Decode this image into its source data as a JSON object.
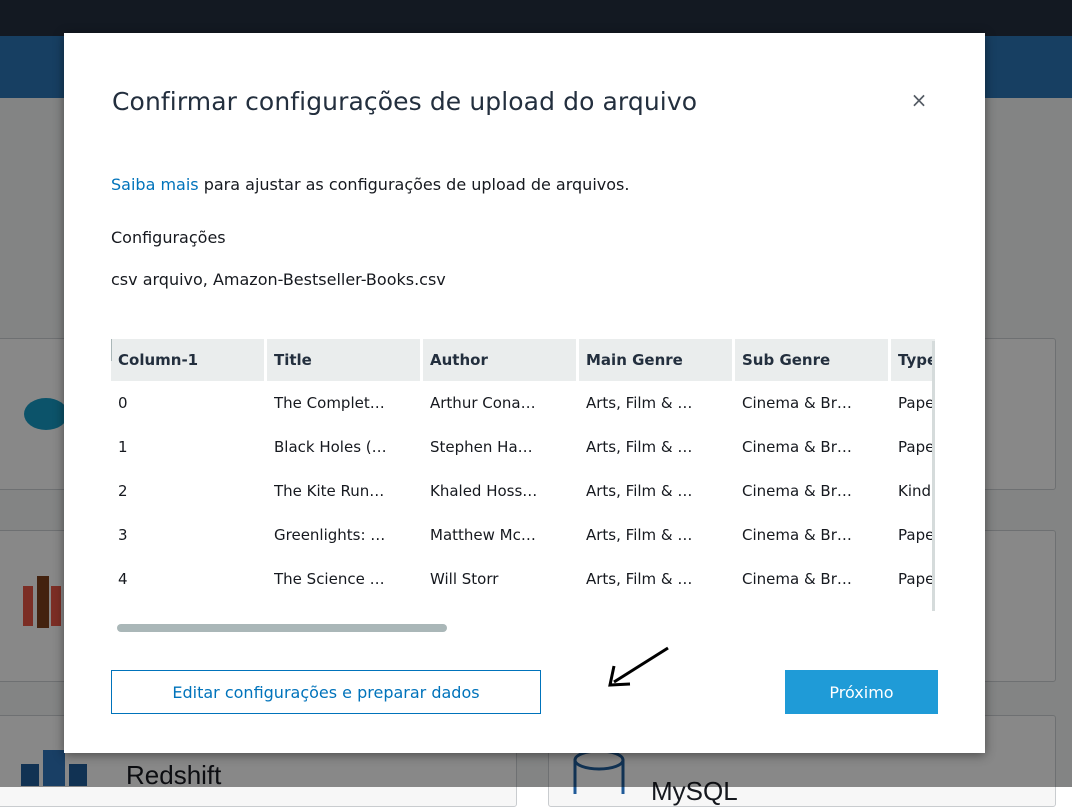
{
  "background": {
    "tiles": [
      {
        "label": "Redshift"
      },
      {
        "label": "MySQL"
      }
    ]
  },
  "modal": {
    "title": "Confirmar configurações de upload do arquivo",
    "close_label": "×",
    "help": {
      "link_text": "Saiba mais",
      "rest_text": " para ajustar as configurações de upload de arquivos."
    },
    "settings_heading": "Configurações",
    "file_info": "csv arquivo, Amazon-Bestseller-Books.csv",
    "table": {
      "columns": [
        "Column-1",
        "Title",
        "Author",
        "Main Genre",
        "Sub Genre",
        "Type"
      ],
      "rows": [
        [
          "0",
          "The Complet…",
          "Arthur Cona…",
          "Arts, Film & …",
          "Cinema & Br…",
          "Paper"
        ],
        [
          "1",
          "Black Holes (…",
          "Stephen Ha…",
          "Arts, Film & …",
          "Cinema & Br…",
          "Paper"
        ],
        [
          "2",
          "The Kite Run…",
          "Khaled Hoss…",
          "Arts, Film & …",
          "Cinema & Br…",
          "Kindle"
        ],
        [
          "3",
          "Greenlights: …",
          "Matthew Mc…",
          "Arts, Film & …",
          "Cinema & Br…",
          "Paper"
        ],
        [
          "4",
          "The Science …",
          "Will Storr",
          "Arts, Film & …",
          "Cinema & Br…",
          "Paper"
        ]
      ]
    },
    "buttons": {
      "edit": "Editar configurações e preparar dados",
      "next": "Próximo"
    }
  },
  "colors": {
    "link": "#0073bb",
    "primary_button": "#1f9bd7",
    "header_bg": "#eaeded"
  }
}
